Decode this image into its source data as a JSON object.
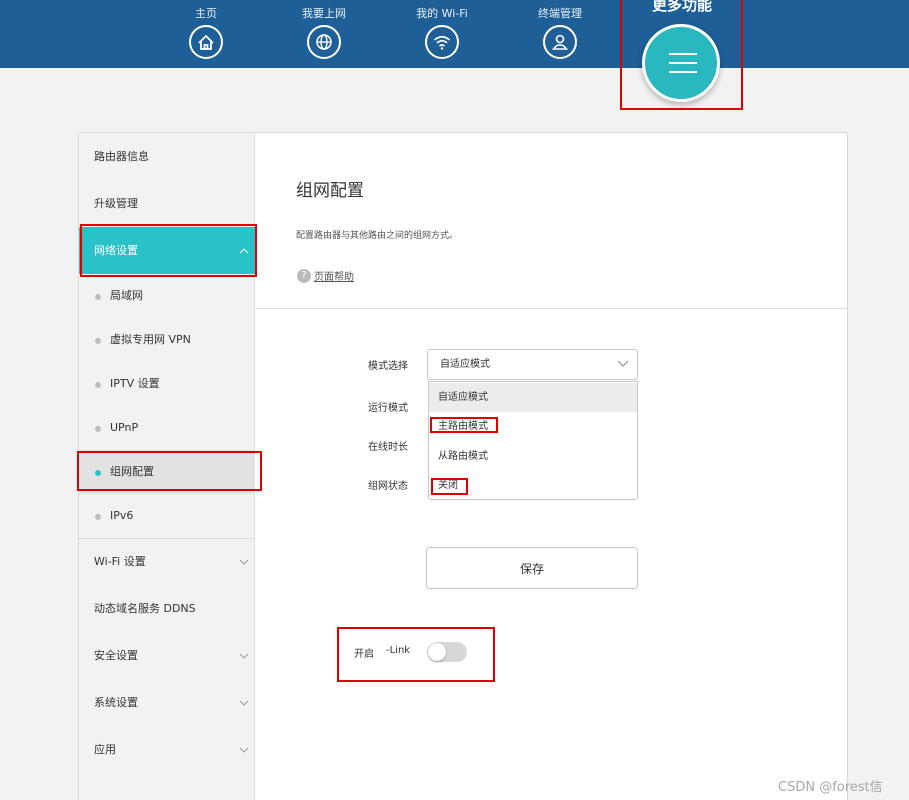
{
  "topnav": {
    "items": [
      {
        "label": "主页",
        "icon": "home-icon"
      },
      {
        "label": "我要上网",
        "icon": "globe-icon"
      },
      {
        "label": "我的 Wi-Fi",
        "icon": "wifi-icon"
      },
      {
        "label": "终端管理",
        "icon": "user-icon"
      }
    ],
    "more_label": "更多功能",
    "more_icon": "menu-icon"
  },
  "sidebar": {
    "items": [
      {
        "label": "路由器信息"
      },
      {
        "label": "升级管理"
      },
      {
        "label": "网络设置",
        "expanded": true
      },
      {
        "label": "Wi-Fi 设置"
      },
      {
        "label": "动态域名服务 DDNS"
      },
      {
        "label": "安全设置"
      },
      {
        "label": "系统设置"
      },
      {
        "label": "应用"
      }
    ],
    "network_sub": [
      {
        "label": "局域网"
      },
      {
        "label": "虚拟专用网 VPN"
      },
      {
        "label": "IPTV 设置"
      },
      {
        "label": "UPnP"
      },
      {
        "label": "组网配置",
        "selected": true
      },
      {
        "label": "IPv6"
      }
    ]
  },
  "main": {
    "title": "组网配置",
    "description": "配置路由器与其他路由之间的组网方式。",
    "help_label": "页面帮助",
    "help_icon": "?",
    "form": {
      "mode_label": "模式选择",
      "mode_value": "自适应模式",
      "run_mode_label": "运行模式",
      "online_time_label": "在线时长",
      "status_label": "组网状态",
      "options": [
        "自适应模式",
        "主路由模式",
        "从路由模式",
        "关闭"
      ]
    },
    "save_label": "保存",
    "switch": {
      "label_on": "开启",
      "label_link": "-Link",
      "enabled": false
    }
  },
  "watermark": "CSDN @forest信",
  "colors": {
    "header": "#1d5f96",
    "accent": "#2ac2c9",
    "highlight": "#e00000"
  }
}
